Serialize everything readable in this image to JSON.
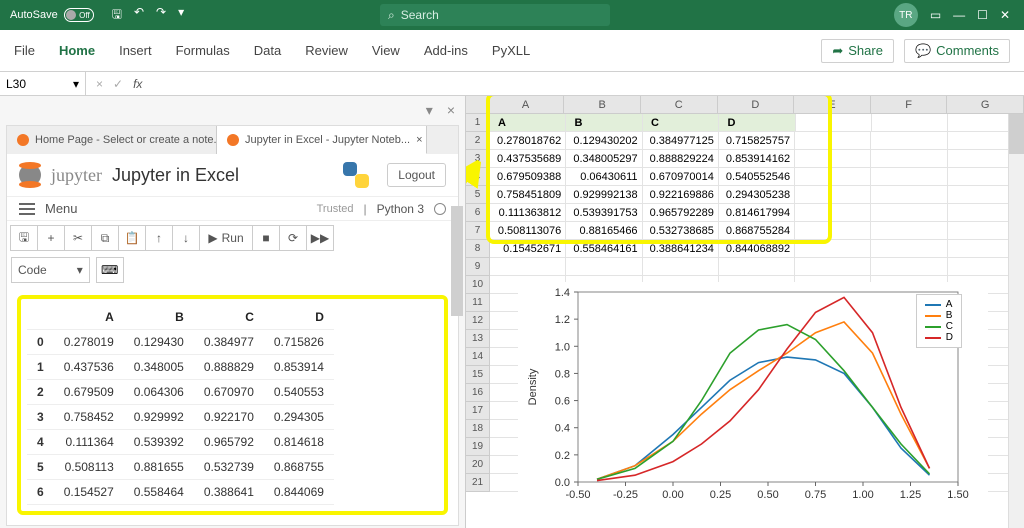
{
  "titlebar": {
    "autosave_label": "AutoSave",
    "autosave_state": "Off",
    "search_placeholder": "Search",
    "user_initials": "TR"
  },
  "ribbon": {
    "tabs": [
      "File",
      "Home",
      "Insert",
      "Formulas",
      "Data",
      "Review",
      "View",
      "Add-ins",
      "PyXLL"
    ],
    "share": "Share",
    "comments": "Comments"
  },
  "fbar": {
    "namebox": "L30",
    "formula": ""
  },
  "pane": {
    "tab1": "Home Page - Select or create a note...",
    "tab2": "Jupyter in Excel - Jupyter Noteb...",
    "jupyter_name": "jupyter",
    "nb_title": "Jupyter in Excel",
    "logout": "Logout",
    "menu": "Menu",
    "trusted": "Trusted",
    "kernel": "Python 3",
    "run_label": "Run",
    "code_label": "Code"
  },
  "icons": {
    "down": "▾",
    "close": "×",
    "save": "🖫",
    "plus": "+",
    "cut": "✂",
    "copy": "⧉",
    "paste": "📋",
    "up": "↑",
    "downarr": "↓",
    "play": "▶",
    "stop": "■",
    "reload": "⟳",
    "ff": "▶▶",
    "dropdown": "▾",
    "hamburger": "≡",
    "undo": "↶",
    "redo": "↷",
    "min": "—",
    "max": "☐",
    "x": "✕",
    "simple": "▭",
    "cmt": "💬",
    "share": "➦",
    "kb": "⌨"
  },
  "df": {
    "cols": [
      "A",
      "B",
      "C",
      "D"
    ],
    "idx": [
      "0",
      "1",
      "2",
      "3",
      "4",
      "5",
      "6"
    ],
    "data": [
      [
        "0.278019",
        "0.129430",
        "0.384977",
        "0.715826"
      ],
      [
        "0.437536",
        "0.348005",
        "0.888829",
        "0.853914"
      ],
      [
        "0.679509",
        "0.064306",
        "0.670970",
        "0.540553"
      ],
      [
        "0.758452",
        "0.929992",
        "0.922170",
        "0.294305"
      ],
      [
        "0.111364",
        "0.539392",
        "0.965792",
        "0.814618"
      ],
      [
        "0.508113",
        "0.881655",
        "0.532739",
        "0.868755"
      ],
      [
        "0.154527",
        "0.558464",
        "0.388641",
        "0.844069"
      ]
    ]
  },
  "sheet": {
    "col_letters": [
      "A",
      "B",
      "C",
      "D",
      "E",
      "F",
      "G"
    ],
    "row_nums": [
      "1",
      "2",
      "3",
      "4",
      "5",
      "6",
      "7",
      "8",
      "9",
      "10",
      "11",
      "12",
      "13",
      "14",
      "15",
      "16",
      "17",
      "18",
      "19",
      "20",
      "21"
    ],
    "header_row": [
      "A",
      "B",
      "C",
      "D"
    ],
    "data": [
      [
        "0.278018762",
        "0.129430202",
        "0.384977125",
        "0.715825757"
      ],
      [
        "0.437535689",
        "0.348005297",
        "0.888829224",
        "0.853914162"
      ],
      [
        "0.679509388",
        "0.06430611",
        "0.670970014",
        "0.540552546"
      ],
      [
        "0.758451809",
        "0.929992138",
        "0.922169886",
        "0.294305238"
      ],
      [
        "0.111363812",
        "0.539391753",
        "0.965792289",
        "0.814617994"
      ],
      [
        "0.508113076",
        "0.88165466",
        "0.532738685",
        "0.868755284"
      ],
      [
        "0.15452671",
        "0.558464161",
        "0.388641234",
        "0.844068892"
      ]
    ]
  },
  "chart_data": {
    "type": "line",
    "title": "",
    "xlabel": "",
    "ylabel": "Density",
    "x_ticks": [
      "-0.50",
      "-0.25",
      "0.00",
      "0.25",
      "0.50",
      "0.75",
      "1.00",
      "1.25",
      "1.50"
    ],
    "y_ticks": [
      "0.0",
      "0.2",
      "0.4",
      "0.6",
      "0.8",
      "1.0",
      "1.2",
      "1.4"
    ],
    "xlim": [
      -0.5,
      1.5
    ],
    "ylim": [
      0.0,
      1.4
    ],
    "legend": [
      "A",
      "B",
      "C",
      "D"
    ],
    "colors": {
      "A": "#1f77b4",
      "B": "#ff7f0e",
      "C": "#2ca02c",
      "D": "#d62728"
    },
    "series": [
      {
        "name": "A",
        "x": [
          -0.4,
          -0.2,
          0.0,
          0.15,
          0.3,
          0.45,
          0.6,
          0.75,
          0.9,
          1.05,
          1.2,
          1.35
        ],
        "y": [
          0.02,
          0.12,
          0.35,
          0.55,
          0.75,
          0.88,
          0.92,
          0.9,
          0.8,
          0.55,
          0.25,
          0.05
        ]
      },
      {
        "name": "B",
        "x": [
          -0.4,
          -0.2,
          0.0,
          0.15,
          0.3,
          0.45,
          0.6,
          0.75,
          0.9,
          1.05,
          1.2,
          1.35
        ],
        "y": [
          0.02,
          0.12,
          0.3,
          0.5,
          0.68,
          0.82,
          0.95,
          1.1,
          1.18,
          0.95,
          0.5,
          0.1
        ]
      },
      {
        "name": "C",
        "x": [
          -0.4,
          -0.2,
          0.0,
          0.15,
          0.3,
          0.45,
          0.6,
          0.75,
          0.9,
          1.05,
          1.2,
          1.35
        ],
        "y": [
          0.02,
          0.1,
          0.3,
          0.6,
          0.95,
          1.12,
          1.16,
          1.05,
          0.82,
          0.55,
          0.28,
          0.06
        ]
      },
      {
        "name": "D",
        "x": [
          -0.4,
          -0.2,
          0.0,
          0.15,
          0.3,
          0.45,
          0.6,
          0.75,
          0.9,
          1.05,
          1.2,
          1.35
        ],
        "y": [
          0.01,
          0.05,
          0.15,
          0.28,
          0.45,
          0.68,
          0.98,
          1.25,
          1.36,
          1.1,
          0.55,
          0.1
        ]
      }
    ]
  }
}
